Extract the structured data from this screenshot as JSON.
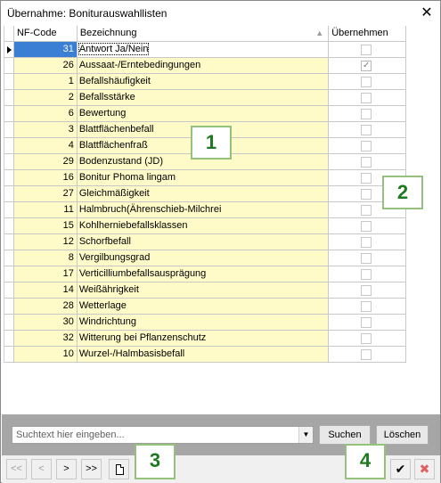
{
  "window": {
    "title": "Übernahme: Boniturauswahllisten",
    "close_glyph": "✕"
  },
  "grid": {
    "columns": {
      "code": "NF-Code",
      "name": "Bezeichnung",
      "take": "Übernehmen"
    },
    "sort_icon": "▲",
    "rows": [
      {
        "code": "31",
        "name": "Antwort Ja/Nein",
        "checked": false,
        "selected": true
      },
      {
        "code": "26",
        "name": "Aussaat-/Erntebedingungen",
        "checked": true,
        "selected": false
      },
      {
        "code": "1",
        "name": "Befallshäufigkeit",
        "checked": false,
        "selected": false
      },
      {
        "code": "2",
        "name": "Befallsstärke",
        "checked": false,
        "selected": false
      },
      {
        "code": "6",
        "name": "Bewertung",
        "checked": false,
        "selected": false
      },
      {
        "code": "3",
        "name": "Blattflächenbefall",
        "checked": false,
        "selected": false
      },
      {
        "code": "4",
        "name": "Blattflächenfraß",
        "checked": false,
        "selected": false
      },
      {
        "code": "29",
        "name": "Bodenzustand (JD)",
        "checked": false,
        "selected": false
      },
      {
        "code": "16",
        "name": "Bonitur Phoma lingam",
        "checked": false,
        "selected": false
      },
      {
        "code": "27",
        "name": "Gleichmäßigkeit",
        "checked": false,
        "selected": false
      },
      {
        "code": "11",
        "name": "Halmbruch(Ährenschieb-Milchrei",
        "checked": false,
        "selected": false
      },
      {
        "code": "15",
        "name": "Kohlherniebefallsklassen",
        "checked": false,
        "selected": false
      },
      {
        "code": "12",
        "name": "Schorfbefall",
        "checked": false,
        "selected": false
      },
      {
        "code": "8",
        "name": "Vergilbungsgrad",
        "checked": false,
        "selected": false
      },
      {
        "code": "17",
        "name": "Verticilliumbefallsausprägung",
        "checked": false,
        "selected": false
      },
      {
        "code": "14",
        "name": "Weißährigkeit",
        "checked": false,
        "selected": false
      },
      {
        "code": "28",
        "name": "Wetterlage",
        "checked": false,
        "selected": false
      },
      {
        "code": "30",
        "name": "Windrichtung",
        "checked": false,
        "selected": false
      },
      {
        "code": "32",
        "name": "Witterung bei  Pflanzenschutz",
        "checked": false,
        "selected": false
      },
      {
        "code": "10",
        "name": "Wurzel-/Halmbasisbefall",
        "checked": false,
        "selected": false
      }
    ]
  },
  "search": {
    "placeholder": "Suchtext hier eingeben...",
    "search_label": "Suchen",
    "clear_label": "Löschen"
  },
  "nav": {
    "first": "<<",
    "prev": "<",
    "next": ">",
    "last": ">>",
    "ok_glyph": "✔",
    "cancel_glyph": "✖"
  },
  "badges": {
    "b1": "1",
    "b2": "2",
    "b3": "3",
    "b4": "4"
  },
  "colors": {
    "cell_bg": "#fffbc8",
    "selected_bg": "#3b7fd4",
    "badge_text": "#1f7a1f",
    "badge_border": "#94c27c",
    "bottom_bar": "#a6a6a6"
  }
}
